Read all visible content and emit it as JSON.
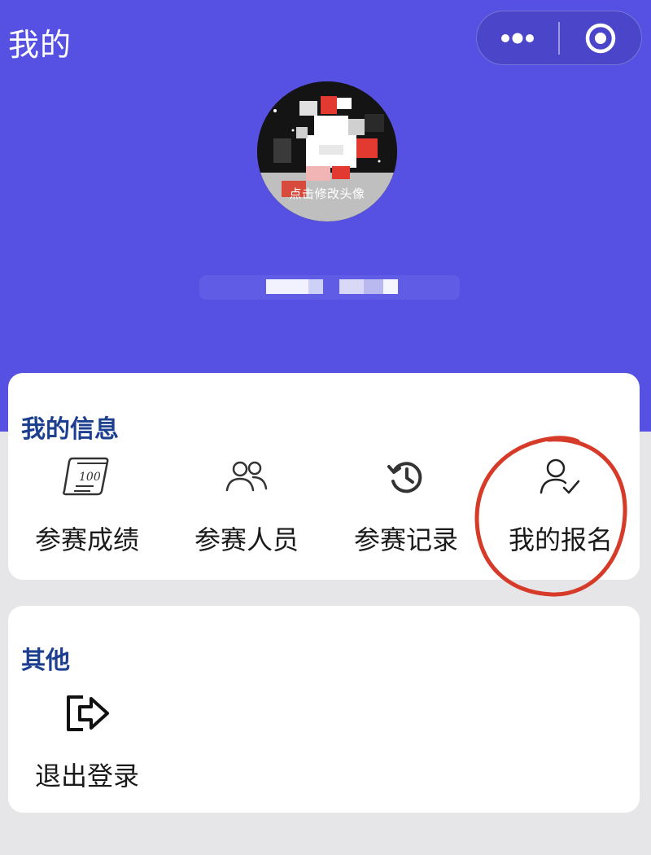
{
  "header": {
    "title": "我的",
    "capsule": {
      "more_icon": "more-dots-icon",
      "close_icon": "target-icon"
    }
  },
  "profile": {
    "avatar_hint": "点击修改头像"
  },
  "my_info": {
    "title": "我的信息",
    "items": [
      {
        "label": "参赛成绩",
        "icon": "score-sheet-icon"
      },
      {
        "label": "参赛人员",
        "icon": "people-icon"
      },
      {
        "label": "参赛记录",
        "icon": "history-clock-icon"
      },
      {
        "label": "我的报名",
        "icon": "user-check-icon"
      }
    ]
  },
  "other": {
    "title": "其他",
    "items": [
      {
        "label": "退出登录",
        "icon": "logout-icon"
      }
    ]
  },
  "colors": {
    "header_bg": "#5651e3",
    "section_title": "#1c3f8f",
    "highlight": "#d63a28",
    "page_bg": "#e6e6e9"
  }
}
